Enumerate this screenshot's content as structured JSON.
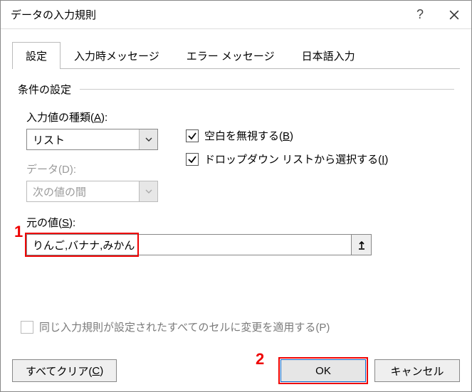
{
  "window": {
    "title": "データの入力規則"
  },
  "tabs": {
    "settings": "設定",
    "input_message": "入力時メッセージ",
    "error_message": "エラー メッセージ",
    "ime": "日本語入力"
  },
  "section": {
    "title": "条件の設定"
  },
  "allow": {
    "label_pre": "入力値の種類(",
    "label_key": "A",
    "label_post": "):",
    "value": "リスト"
  },
  "data": {
    "label": "データ(D):",
    "value": "次の値の間"
  },
  "ignore_blank": {
    "label_pre": "空白を無視する(",
    "label_key": "B",
    "label_post": ")",
    "checked": true
  },
  "incell_dropdown": {
    "label_pre": "ドロップダウン リストから選択する(",
    "label_key": "I",
    "label_post": ")",
    "checked": true
  },
  "source": {
    "label_pre": "元の値(",
    "label_key": "S",
    "label_post": "):",
    "value": "りんご,バナナ,みかん"
  },
  "apply_changes": {
    "label": "同じ入力規則が設定されたすべてのセルに変更を適用する(P)",
    "checked": false
  },
  "footer": {
    "clear_pre": "すべてクリア(",
    "clear_key": "C",
    "clear_post": ")",
    "ok": "OK",
    "cancel": "キャンセル"
  },
  "annotations": {
    "one": "1",
    "two": "2"
  }
}
